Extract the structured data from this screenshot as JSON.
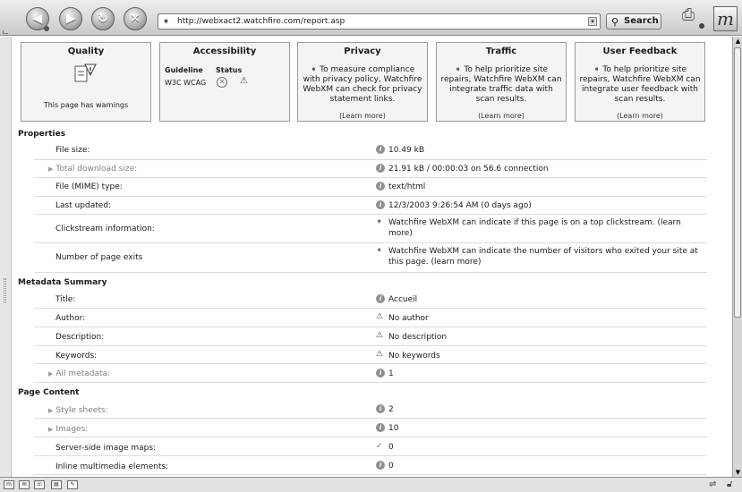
{
  "browser": {
    "url": "http://webxact2.watchfire.com/report.asp",
    "search_label": "Search",
    "logo_letter": "m"
  },
  "panels": {
    "quality": {
      "title": "Quality",
      "caption": "This page has warnings"
    },
    "accessibility": {
      "title": "Accessibility",
      "col_guideline": "Guideline",
      "col_status": "Status",
      "guideline_value": "W3C WCAG"
    },
    "privacy": {
      "title": "Privacy",
      "text": "To measure compliance with privacy policy, Watchfire WebXM can check for privacy statement links.",
      "learn": "(Learn more)"
    },
    "traffic": {
      "title": "Traffic",
      "text": "To help prioritize site repairs, Watchfire WebXM can integrate traffic data with scan results.",
      "learn": "(Learn more)"
    },
    "feedback": {
      "title": "User Feedback",
      "text": "To help prioritize site repairs, Watchfire WebXM can integrate user feedback with scan results.",
      "learn": "(Learn more)"
    }
  },
  "properties": {
    "heading": "Properties",
    "rows": [
      {
        "label": "File size:",
        "value": "10.49 kB"
      },
      {
        "label": "Total download size:",
        "value": "21.91 kB / 00:00:03 on 56.6 connection"
      },
      {
        "label": "File (MIME) type:",
        "value": "text/html"
      },
      {
        "label": "Last updated:",
        "value": "12/3/2003 9:26:54 AM  (0 days ago)"
      },
      {
        "label": "Clickstream information:",
        "value": "Watchfire WebXM can indicate if this page is on a top clickstream. (learn more)"
      },
      {
        "label": "Number of page exits",
        "value": "Watchfire WebXM can indicate the number of visitors who exited your site at this page. (learn more)"
      }
    ]
  },
  "metadata": {
    "heading": "Metadata Summary",
    "rows": [
      {
        "label": "Title:",
        "value": "Accueil"
      },
      {
        "label": "Author:",
        "value": "No author"
      },
      {
        "label": "Description:",
        "value": "No description"
      },
      {
        "label": "Keywords:",
        "value": "No keywords"
      },
      {
        "label": "All metadata:",
        "value": "1"
      }
    ]
  },
  "content": {
    "heading": "Page Content",
    "rows": [
      {
        "label": "Style sheets:",
        "value": "2"
      },
      {
        "label": "Images:",
        "value": "10"
      },
      {
        "label": "Server-side image maps:",
        "value": "0"
      },
      {
        "label": "Inline multimedia elements:",
        "value": "0"
      }
    ]
  },
  "icons": {
    "info": "info-icon",
    "warning": "warning-icon",
    "check": "check-icon",
    "error": "error-icon",
    "arrow": "arrow-icon"
  }
}
